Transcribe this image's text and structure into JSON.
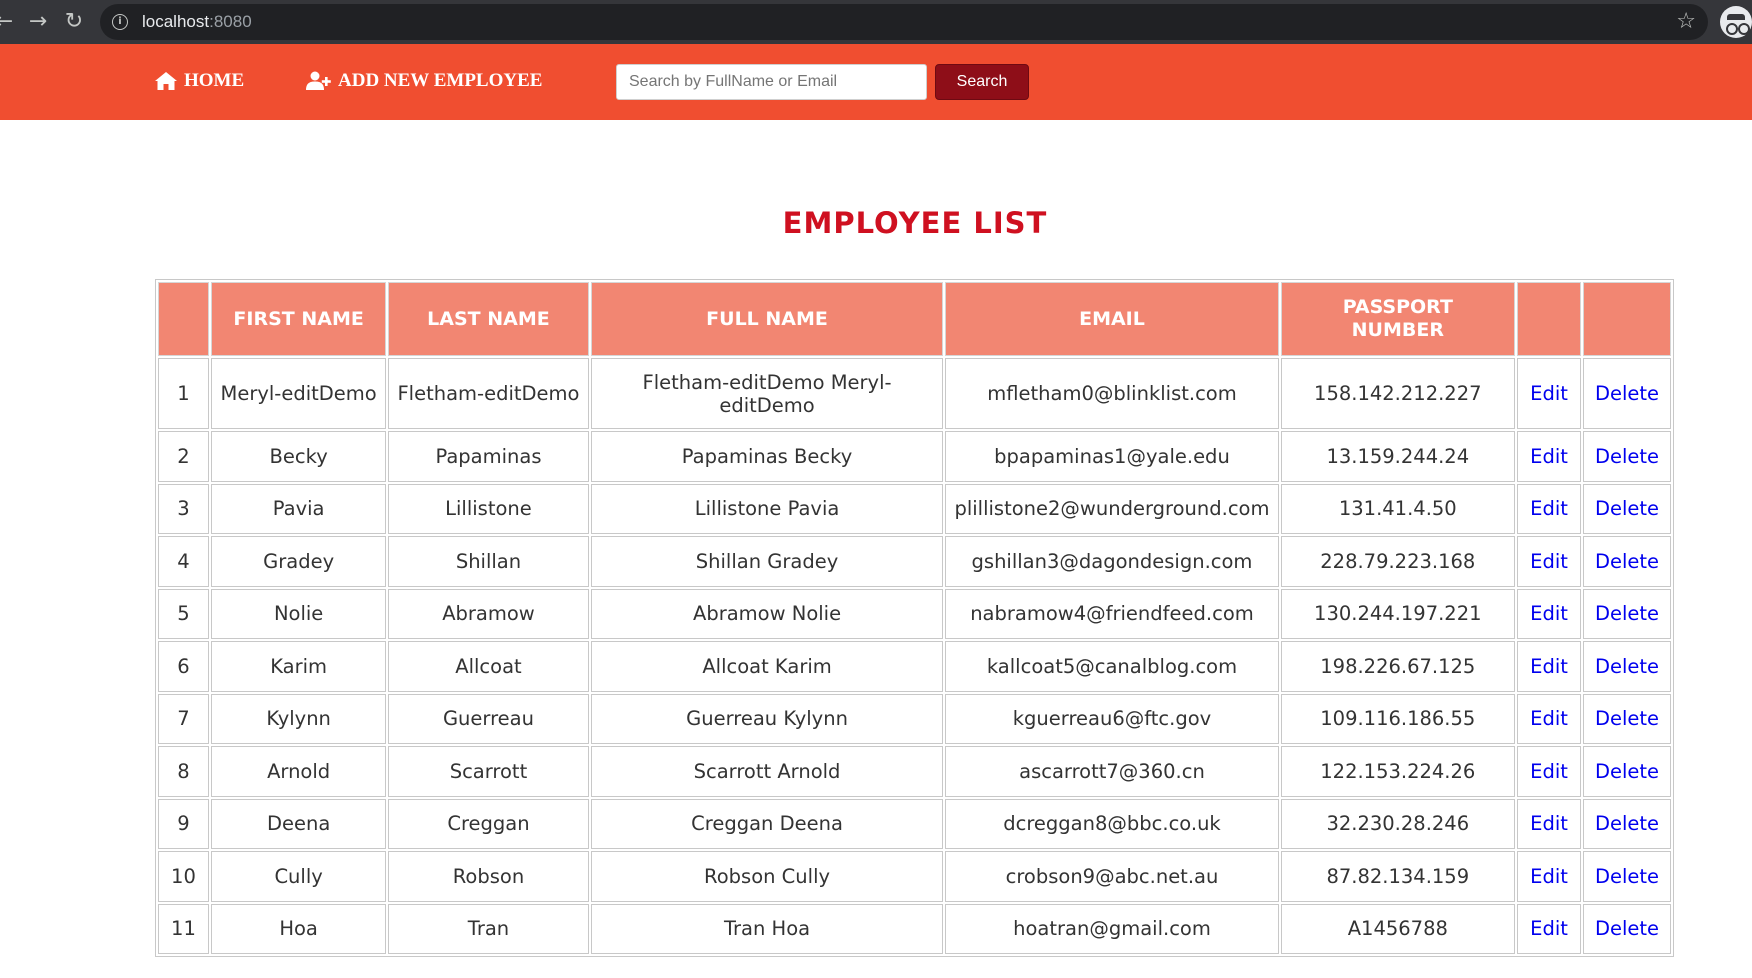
{
  "browser": {
    "url_host": "localhost",
    "url_port": ":8080"
  },
  "nav": {
    "home_label": "HOME",
    "add_label": "ADD NEW EMPLOYEE",
    "search_placeholder": "Search by FullName or Email",
    "search_value": "",
    "search_button": "Search"
  },
  "page": {
    "title": "EMPLOYEE LIST"
  },
  "table": {
    "headers": [
      "",
      "FIRST NAME",
      "LAST NAME",
      "FULL NAME",
      "EMAIL",
      "PASSPORT NUMBER",
      "",
      ""
    ],
    "edit_label": "Edit",
    "delete_label": "Delete",
    "rows": [
      {
        "id": "1",
        "first": "Meryl-editDemo",
        "last": "Fletham-editDemo",
        "full": "Fletham-editDemo Meryl-editDemo",
        "email": "mfletham0@blinklist.com",
        "passport": "158.142.212.227"
      },
      {
        "id": "2",
        "first": "Becky",
        "last": "Papaminas",
        "full": "Papaminas Becky",
        "email": "bpapaminas1@yale.edu",
        "passport": "13.159.244.24"
      },
      {
        "id": "3",
        "first": "Pavia",
        "last": "Lillistone",
        "full": "Lillistone Pavia",
        "email": "plillistone2@wunderground.com",
        "passport": "131.41.4.50"
      },
      {
        "id": "4",
        "first": "Gradey",
        "last": "Shillan",
        "full": "Shillan Gradey",
        "email": "gshillan3@dagondesign.com",
        "passport": "228.79.223.168"
      },
      {
        "id": "5",
        "first": "Nolie",
        "last": "Abramow",
        "full": "Abramow Nolie",
        "email": "nabramow4@friendfeed.com",
        "passport": "130.244.197.221"
      },
      {
        "id": "6",
        "first": "Karim",
        "last": "Allcoat",
        "full": "Allcoat Karim",
        "email": "kallcoat5@canalblog.com",
        "passport": "198.226.67.125"
      },
      {
        "id": "7",
        "first": "Kylynn",
        "last": "Guerreau",
        "full": "Guerreau Kylynn",
        "email": "kguerreau6@ftc.gov",
        "passport": "109.116.186.55"
      },
      {
        "id": "8",
        "first": "Arnold",
        "last": "Scarrott",
        "full": "Scarrott Arnold",
        "email": "ascarrott7@360.cn",
        "passport": "122.153.224.26"
      },
      {
        "id": "9",
        "first": "Deena",
        "last": "Creggan",
        "full": "Creggan Deena",
        "email": "dcreggan8@bbc.co.uk",
        "passport": "32.230.28.246"
      },
      {
        "id": "10",
        "first": "Cully",
        "last": "Robson",
        "full": "Robson Cully",
        "email": "crobson9@abc.net.au",
        "passport": "87.82.134.159"
      },
      {
        "id": "11",
        "first": "Hoa",
        "last": "Tran",
        "full": "Tran Hoa",
        "email": "hoatran@gmail.com",
        "passport": "A1456788"
      }
    ]
  },
  "colors": {
    "navbar": "#f04e30",
    "title": "#cf1020",
    "header_bg": "#f28672",
    "search_button": "#8e0e18",
    "link": "#0000ee"
  },
  "icons": {
    "home": "home-icon",
    "add_user": "add-user-icon",
    "back": "back-arrow-icon",
    "forward": "forward-arrow-icon",
    "reload": "reload-icon",
    "info": "info-icon",
    "bookmark": "star-icon",
    "incognito": "incognito-icon"
  }
}
